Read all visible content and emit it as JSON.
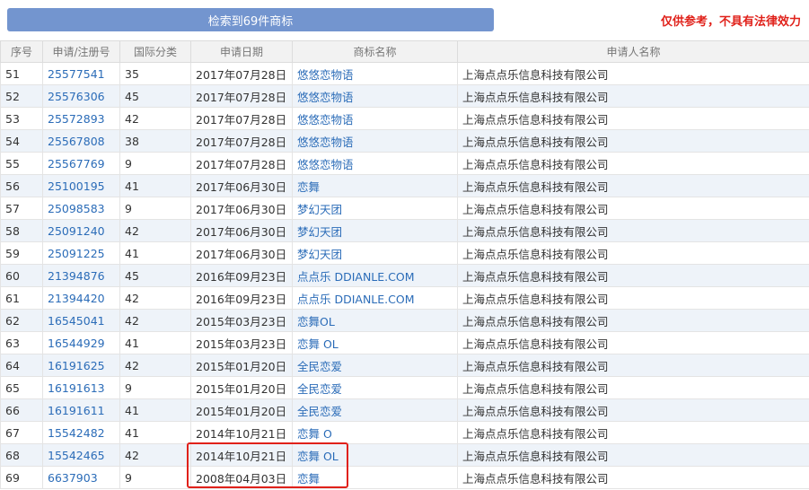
{
  "header": {
    "search_button_label": "检索到69件商标",
    "disclaimer": "仅供参考，不具有法律效力"
  },
  "table": {
    "columns": [
      "序号",
      "申请/注册号",
      "国际分类",
      "申请日期",
      "商标名称",
      "申请人名称"
    ],
    "rows": [
      {
        "index": "51",
        "reg_no": "25577541",
        "class": "35",
        "date": "2017年07月28日",
        "name": "悠悠恋物语",
        "applicant": "上海点点乐信息科技有限公司"
      },
      {
        "index": "52",
        "reg_no": "25576306",
        "class": "45",
        "date": "2017年07月28日",
        "name": "悠悠恋物语",
        "applicant": "上海点点乐信息科技有限公司"
      },
      {
        "index": "53",
        "reg_no": "25572893",
        "class": "42",
        "date": "2017年07月28日",
        "name": "悠悠恋物语",
        "applicant": "上海点点乐信息科技有限公司"
      },
      {
        "index": "54",
        "reg_no": "25567808",
        "class": "38",
        "date": "2017年07月28日",
        "name": "悠悠恋物语",
        "applicant": "上海点点乐信息科技有限公司"
      },
      {
        "index": "55",
        "reg_no": "25567769",
        "class": "9",
        "date": "2017年07月28日",
        "name": "悠悠恋物语",
        "applicant": "上海点点乐信息科技有限公司"
      },
      {
        "index": "56",
        "reg_no": "25100195",
        "class": "41",
        "date": "2017年06月30日",
        "name": "恋舞",
        "applicant": "上海点点乐信息科技有限公司"
      },
      {
        "index": "57",
        "reg_no": "25098583",
        "class": "9",
        "date": "2017年06月30日",
        "name": "梦幻天团",
        "applicant": "上海点点乐信息科技有限公司"
      },
      {
        "index": "58",
        "reg_no": "25091240",
        "class": "42",
        "date": "2017年06月30日",
        "name": "梦幻天团",
        "applicant": "上海点点乐信息科技有限公司"
      },
      {
        "index": "59",
        "reg_no": "25091225",
        "class": "41",
        "date": "2017年06月30日",
        "name": "梦幻天团",
        "applicant": "上海点点乐信息科技有限公司"
      },
      {
        "index": "60",
        "reg_no": "21394876",
        "class": "45",
        "date": "2016年09月23日",
        "name": "点点乐 DDIANLE.COM",
        "applicant": "上海点点乐信息科技有限公司"
      },
      {
        "index": "61",
        "reg_no": "21394420",
        "class": "42",
        "date": "2016年09月23日",
        "name": "点点乐 DDIANLE.COM",
        "applicant": "上海点点乐信息科技有限公司"
      },
      {
        "index": "62",
        "reg_no": "16545041",
        "class": "42",
        "date": "2015年03月23日",
        "name": "恋舞OL",
        "applicant": "上海点点乐信息科技有限公司"
      },
      {
        "index": "63",
        "reg_no": "16544929",
        "class": "41",
        "date": "2015年03月23日",
        "name": "恋舞 OL",
        "applicant": "上海点点乐信息科技有限公司"
      },
      {
        "index": "64",
        "reg_no": "16191625",
        "class": "42",
        "date": "2015年01月20日",
        "name": "全民恋爱",
        "applicant": "上海点点乐信息科技有限公司"
      },
      {
        "index": "65",
        "reg_no": "16191613",
        "class": "9",
        "date": "2015年01月20日",
        "name": "全民恋爱",
        "applicant": "上海点点乐信息科技有限公司"
      },
      {
        "index": "66",
        "reg_no": "16191611",
        "class": "41",
        "date": "2015年01月20日",
        "name": "全民恋爱",
        "applicant": "上海点点乐信息科技有限公司"
      },
      {
        "index": "67",
        "reg_no": "15542482",
        "class": "41",
        "date": "2014年10月21日",
        "name": "恋舞 O",
        "applicant": "上海点点乐信息科技有限公司"
      },
      {
        "index": "68",
        "reg_no": "15542465",
        "class": "42",
        "date": "2014年10月21日",
        "name": "恋舞 OL",
        "applicant": "上海点点乐信息科技有限公司"
      },
      {
        "index": "69",
        "reg_no": "6637903",
        "class": "9",
        "date": "2008年04月03日",
        "name": "恋舞",
        "applicant": "上海点点乐信息科技有限公司"
      }
    ]
  },
  "colors": {
    "accent": "#7395cf",
    "link": "#2b6cb8",
    "warning": "#e0211a",
    "row_stripe": "#eef3f9"
  }
}
